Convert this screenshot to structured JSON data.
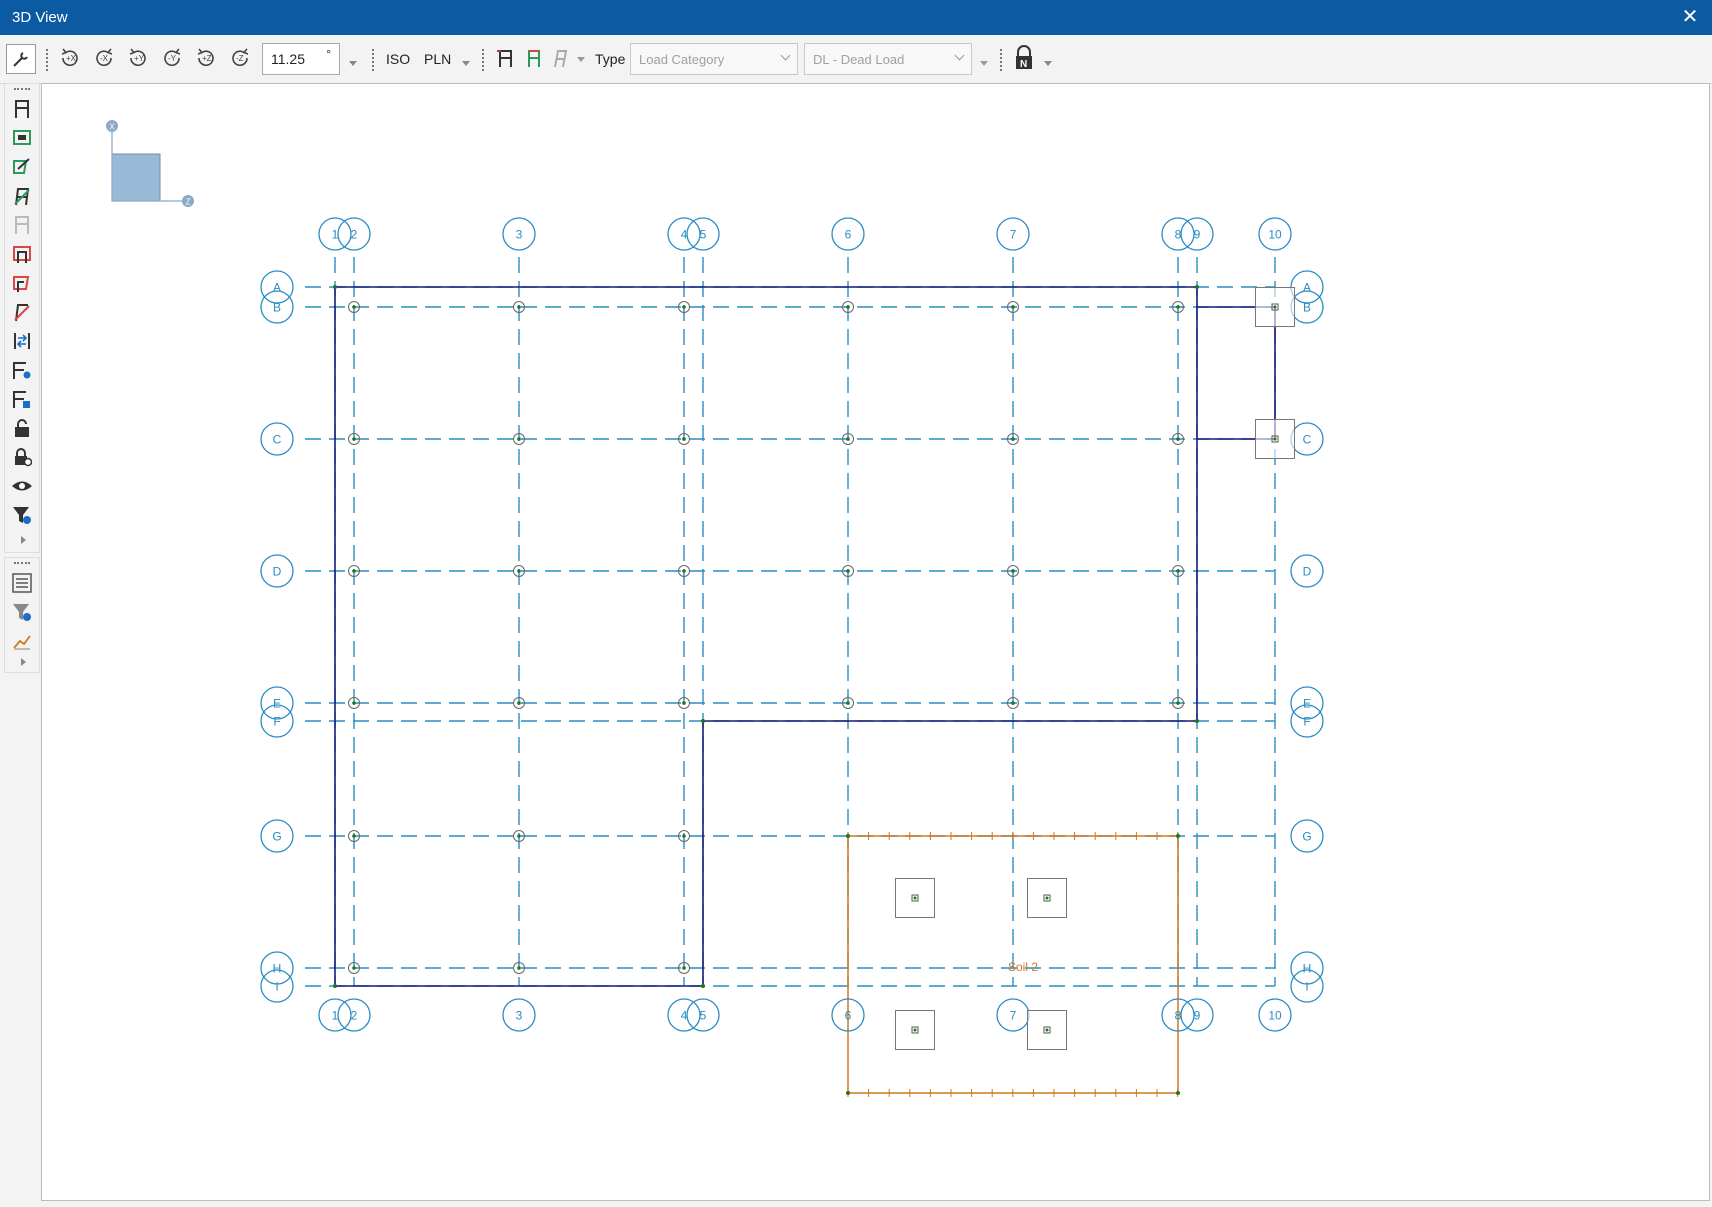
{
  "window": {
    "title": "3D View",
    "close_label": "✕"
  },
  "toolbar": {
    "rotate_buttons": [
      "+X",
      "-X",
      "+Y",
      "-Y",
      "+Z",
      "-Z"
    ],
    "angle_value": "11.25",
    "angle_unit": "°",
    "iso_label": "ISO",
    "pln_label": "PLN",
    "type_label": "Type",
    "load_category_placeholder": "Load Category",
    "load_case_value": "DL - Dead Load",
    "lock_label": "N"
  },
  "axis_triad": {
    "x_label": "X",
    "z_label": "Z"
  },
  "grid": {
    "column_labels": [
      "1",
      "2",
      "3",
      "4",
      "5",
      "6",
      "7",
      "8",
      "9",
      "10"
    ],
    "row_labels": [
      "A",
      "B",
      "C",
      "D",
      "E",
      "F",
      "G",
      "H",
      "I"
    ]
  },
  "soil": {
    "label": "Soil 2"
  },
  "colors": {
    "titlebar": "#0b5aa2",
    "grid_line": "#2a8cc4",
    "slab_outline": "#1a1a7a",
    "soil_outline": "#d07820",
    "node": "#1a7a1a"
  }
}
